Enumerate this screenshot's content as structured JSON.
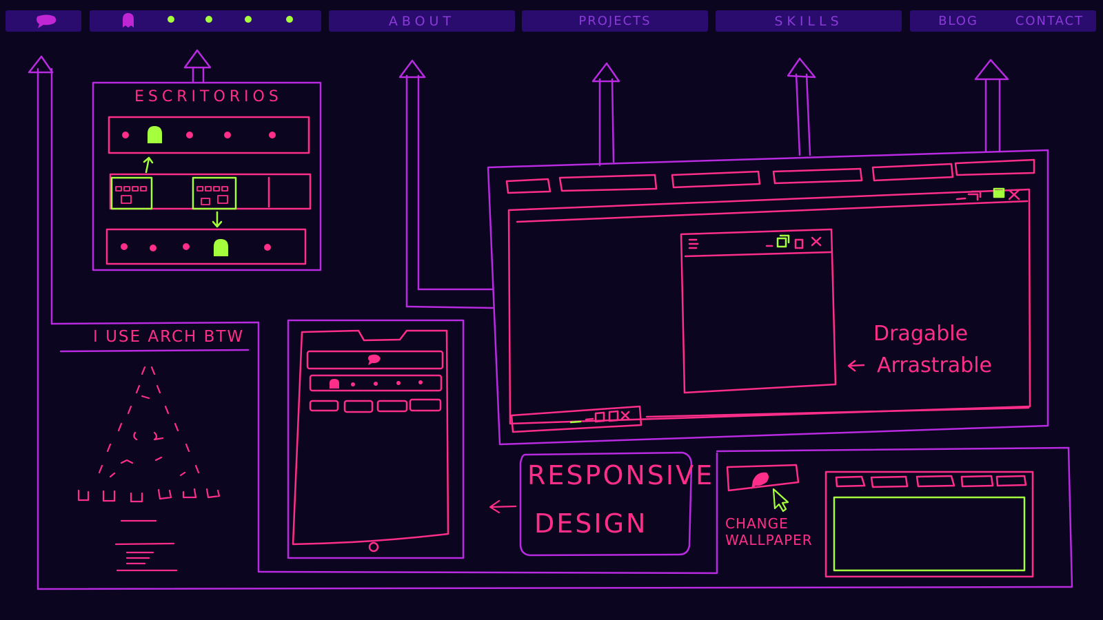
{
  "nav": {
    "items": [
      {
        "label": "ABOUT"
      },
      {
        "label": "PROJECTS"
      },
      {
        "label": "SKILLS"
      },
      {
        "label": "BLOG"
      },
      {
        "label": "CONTACT"
      }
    ]
  },
  "panels": {
    "escritorios_title": "ESCRITORIOS",
    "arch_title": "I USE ARCH BTW",
    "responsive_line1": "RESPONSIVE",
    "responsive_line2": "DESIGN",
    "wallpaper_line1": "CHANGE",
    "wallpaper_line2": "WALLPAPER",
    "drag_line1": "Dragable",
    "drag_line2": "Arrastrable"
  },
  "colors": {
    "background": "#0b0520",
    "purple": "#b82be0",
    "pink": "#ff2e8a",
    "green": "#a6ff3c",
    "nav_fill": "#2a0c6e"
  },
  "icons": [
    "chat-bubble-icon",
    "ghost-icon",
    "cursor-icon",
    "minimize-icon",
    "restore-icon",
    "maximize-icon",
    "close-icon",
    "hamburger-icon",
    "arrow-left-icon"
  ]
}
